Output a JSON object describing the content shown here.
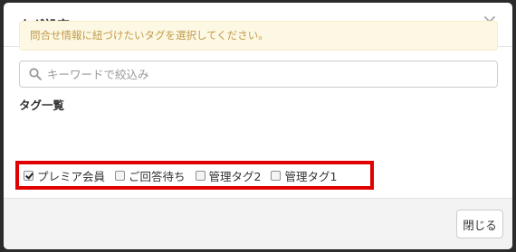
{
  "modal": {
    "title": "タグ設定",
    "close_icon": "×"
  },
  "alert": {
    "message": "問合せ情報に紐づけたいタグを選択してください。"
  },
  "search": {
    "placeholder": "キーワードで絞込み",
    "value": "",
    "icon": "search-icon"
  },
  "tags": {
    "label": "タグ一覧",
    "items": [
      {
        "label": "プレミア会員",
        "checked": true
      },
      {
        "label": "ご回答待ち",
        "checked": false
      },
      {
        "label": "管理タグ2",
        "checked": false
      },
      {
        "label": "管理タグ1",
        "checked": false
      }
    ]
  },
  "footer": {
    "close_label": "閉じる"
  },
  "colors": {
    "alert_bg": "#fcf8e3",
    "alert_text": "#c39b4a",
    "highlight_border": "#e00000",
    "footer_bg": "#f3f3f3"
  }
}
